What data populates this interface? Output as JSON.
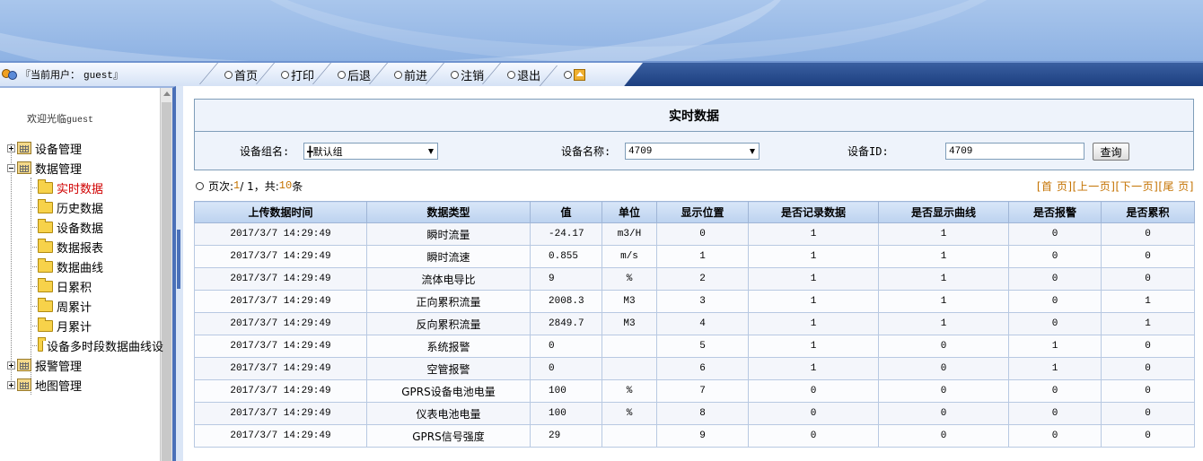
{
  "header": {
    "user_label": "『当前用户：",
    "user_name": "guest』"
  },
  "menu": {
    "items": [
      {
        "label": "首页"
      },
      {
        "label": "打印"
      },
      {
        "label": "后退"
      },
      {
        "label": "前进"
      },
      {
        "label": "注销"
      },
      {
        "label": "退出"
      }
    ]
  },
  "sidebar": {
    "welcome": "欢迎光临",
    "welcome_user": "guest",
    "groups": [
      {
        "label": "设备管理",
        "expanded": false
      },
      {
        "label": "数据管理",
        "expanded": true
      },
      {
        "label": "报警管理",
        "expanded": false
      },
      {
        "label": "地图管理",
        "expanded": false
      }
    ],
    "children": [
      {
        "label": "实时数据",
        "active": true
      },
      {
        "label": "历史数据"
      },
      {
        "label": "设备数据"
      },
      {
        "label": "数据报表"
      },
      {
        "label": "数据曲线"
      },
      {
        "label": "日累积"
      },
      {
        "label": "周累计"
      },
      {
        "label": "月累计"
      },
      {
        "label": "设备多时段数据曲线设"
      }
    ]
  },
  "query": {
    "title": "实时数据",
    "group_label": "设备组名:",
    "group_value": "╋默认组",
    "device_label": "设备名称:",
    "device_value": "4709",
    "id_label": "设备ID:",
    "id_value": "4709",
    "search_button": "查询"
  },
  "pager": {
    "prefix": "页次:",
    "current": "1",
    "separator": "/ 1，共:",
    "total": "10",
    "suffix": "条",
    "first": "[首 页]",
    "prev": "[上一页]",
    "next": "[下一页]",
    "last": "[尾 页]"
  },
  "table": {
    "headers": [
      "上传数据时间",
      "数据类型",
      "值",
      "单位",
      "显示位置",
      "是否记录数据",
      "是否显示曲线",
      "是否报警",
      "是否累积"
    ],
    "rows": [
      [
        "2017/3/7 14:29:49",
        "瞬时流量",
        "-24.17",
        "m3/H",
        "0",
        "1",
        "1",
        "0",
        "0"
      ],
      [
        "2017/3/7 14:29:49",
        "瞬时流速",
        "0.855",
        "m/s",
        "1",
        "1",
        "1",
        "0",
        "0"
      ],
      [
        "2017/3/7 14:29:49",
        "流体电导比",
        "9",
        "%",
        "2",
        "1",
        "1",
        "0",
        "0"
      ],
      [
        "2017/3/7 14:29:49",
        "正向累积流量",
        "2008.3",
        "M3",
        "3",
        "1",
        "1",
        "0",
        "1"
      ],
      [
        "2017/3/7 14:29:49",
        "反向累积流量",
        "2849.7",
        "M3",
        "4",
        "1",
        "1",
        "0",
        "1"
      ],
      [
        "2017/3/7 14:29:49",
        "系统报警",
        "0",
        "",
        "5",
        "1",
        "0",
        "1",
        "0"
      ],
      [
        "2017/3/7 14:29:49",
        "空管报警",
        "0",
        "",
        "6",
        "1",
        "0",
        "1",
        "0"
      ],
      [
        "2017/3/7 14:29:49",
        "GPRS设备电池电量",
        "100",
        "%",
        "7",
        "0",
        "0",
        "0",
        "0"
      ],
      [
        "2017/3/7 14:29:49",
        "仪表电池电量",
        "100",
        "%",
        "8",
        "0",
        "0",
        "0",
        "0"
      ],
      [
        "2017/3/7 14:29:49",
        "GPRS信号强度",
        "29",
        "",
        "9",
        "0",
        "0",
        "0",
        "0"
      ]
    ]
  },
  "colors": {
    "accent": "#4a70b8",
    "active_tree": "#d00000",
    "pager": "#c47200"
  }
}
